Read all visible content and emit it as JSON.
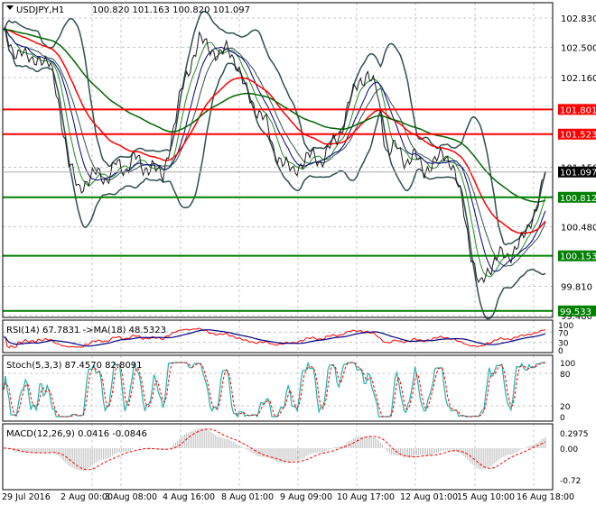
{
  "chart_data": {
    "type": "line",
    "title": "USDJPY,H1",
    "ohlc": {
      "open": "100.820",
      "high": "101.163",
      "low": "100.820",
      "close": "101.097"
    },
    "price_ticks": [
      "102.830",
      "102.500",
      "102.160",
      "101.150",
      "100.480",
      "99.810",
      "99.480"
    ],
    "price_ylim": [
      99.48,
      102.83
    ],
    "levels": [
      {
        "label": "101.801",
        "value": 101.801,
        "color": "#ff0000"
      },
      {
        "label": "101.523",
        "value": 101.523,
        "color": "#ff0000"
      },
      {
        "label": "100.812",
        "value": 100.812,
        "color": "#008000"
      },
      {
        "label": "100.153",
        "value": 100.153,
        "color": "#008000"
      },
      {
        "label": "99.533",
        "value": 99.533,
        "color": "#008000"
      }
    ],
    "current_price": {
      "label": "101.097",
      "value": 101.097
    },
    "closes": [
      102.7,
      102.4,
      102.5,
      102.3,
      102.4,
      102.3,
      101.8,
      101.2,
      100.9,
      101.0,
      101.1,
      101.0,
      101.2,
      101.1,
      101.3,
      101.1,
      101.2,
      101.0,
      101.5,
      102.0,
      102.3,
      102.6,
      102.5,
      102.4,
      102.5,
      102.3,
      102.0,
      101.8,
      101.7,
      101.3,
      101.2,
      101.1,
      101.2,
      101.3,
      101.2,
      101.4,
      101.5,
      101.9,
      102.1,
      102.2,
      102.0,
      101.3,
      101.4,
      101.2,
      101.3,
      101.1,
      101.2,
      101.3,
      101.2,
      100.8,
      100.2,
      99.8,
      100.0,
      100.2,
      100.1,
      100.3,
      100.4,
      100.7,
      101.1
    ],
    "x_labels": [
      "29 Jul 2016",
      "2 Aug 00:00",
      "3 Aug 08:00",
      "4 Aug 16:00",
      "8 Aug 01:00",
      "9 Aug 09:00",
      "10 Aug 17:00",
      "12 Aug 01:00",
      "15 Aug 10:00",
      "16 Aug 18:00"
    ],
    "rsi": {
      "label": "RSI(14) 67.7831  ->MA(18) 48.5323",
      "ticks": [
        "100",
        "70",
        "30",
        "0"
      ]
    },
    "stoch": {
      "label": "Stoch(5,3,3) 87.4570 82.8091",
      "ticks": [
        "100",
        "80",
        "20",
        "0"
      ]
    },
    "macd": {
      "label": "MACD(12,26,9) 0.0416 -0.0846",
      "ticks": [
        "0.2975",
        "0.00",
        "-0.72"
      ]
    },
    "colors": {
      "bands": "#2f4f4f",
      "ma_red": "#ff0000",
      "ma_green": "#006400",
      "rsi": "#ff0000",
      "rsi_ma": "#000080",
      "stoch_main": "#20b2aa",
      "stoch_signal": "#ff0000",
      "macd_hist": "#c0c0c0"
    }
  }
}
